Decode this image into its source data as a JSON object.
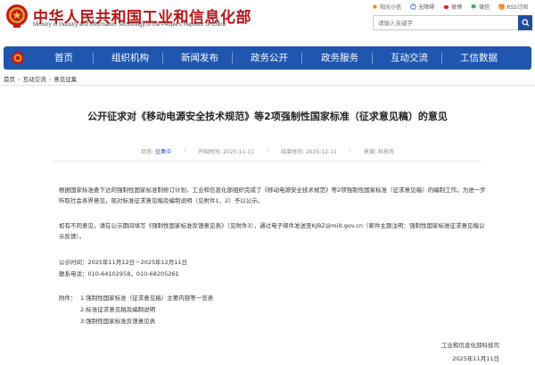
{
  "header": {
    "site_title": "中华人民共和国工业和信息化部",
    "site_subtitle": "Ministry of Industry and Information Technology of the People's Republic of China",
    "top_links": [
      "阳光小信",
      "无障碍",
      "微博",
      "微信",
      "RSS订阅"
    ],
    "search_placeholder": "请输入关键字",
    "brand_color": "#b9151b",
    "nav_color": "#1e56b0"
  },
  "nav": {
    "items": [
      "首页",
      "组织机构",
      "新闻发布",
      "政务公开",
      "政务服务",
      "互动交流",
      "工信数据"
    ]
  },
  "breadcrumb": [
    "首页",
    "互动交流",
    "意见征集"
  ],
  "article": {
    "title": "公开征求对《移动电源安全技术规范》等2项强制性国家标准（征求意见稿）的意见",
    "meta": {
      "status_label": "状态:",
      "status_value": "征集中",
      "start_label": "开始时间:",
      "start_value": "2025-11-11",
      "end_label": "结束时间:",
      "end_value": "2025-12-11",
      "source_label": "来源:",
      "source_value": "科技司"
    },
    "paragraph1": "根据国家标准委下达的强制性国家标准制修订计划，工业和信息化部组织完成了《移动电源安全技术规范》等2项强制性国家标准（征求意见稿）的编制工作。为进一步听取社会各界意见，现对标准征求意见稿及编制说明（见附件1、2）予以公示。",
    "paragraph2": "如有不同意见，请在公示期间填写《强制性国家标准反馈意见表》（见附件3），通过电子邮件发送至KJBZ@miit.gov.cn（邮件主题注明：强制性国家标准征求意见稿公示反馈）。",
    "publicity_time": "公示时间：2025年11月12日－2025年12月11日",
    "phone": "联系电话：010-64102958，010-68205261",
    "attachments_label": "附件：",
    "attachments": [
      "1.强制性国家标准（征求意见稿）主要内容等一览表",
      "2.标准征求意见稿及编制说明",
      "3.强制性国家标准反馈意见表"
    ],
    "signature_org": "工业和信息化部科技司",
    "signature_date": "2025年11月11日"
  }
}
